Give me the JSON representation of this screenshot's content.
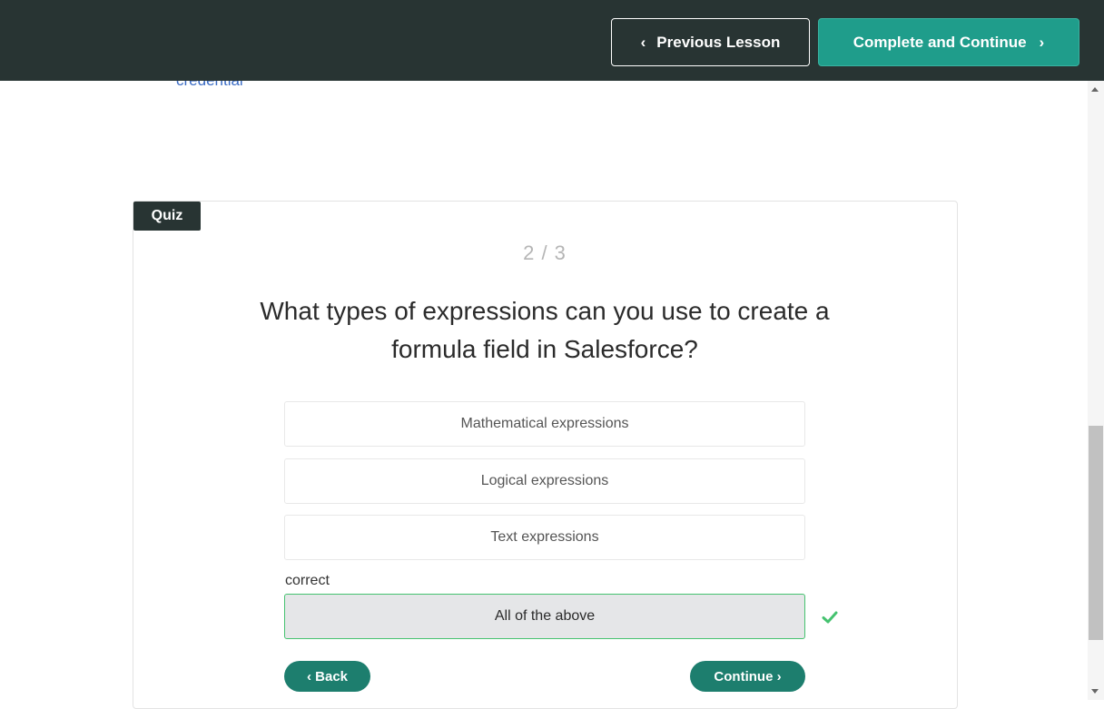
{
  "header": {
    "previous_label": "Previous Lesson",
    "complete_label": "Complete and Continue"
  },
  "content": {
    "cut_off_link": "credential"
  },
  "quiz": {
    "tag": "Quiz",
    "progress": "2 / 3",
    "question": "What types of expressions can you use to create a formula field in Salesforce?",
    "answers": [
      {
        "label": "Mathematical expressions",
        "selected": false
      },
      {
        "label": "Logical expressions",
        "selected": false
      },
      {
        "label": "Text expressions",
        "selected": false
      },
      {
        "label": "All of the above",
        "selected": true
      }
    ],
    "feedback_label": "correct",
    "back_label": "‹ Back",
    "continue_label": "Continue ›"
  },
  "colors": {
    "topbar": "#283433",
    "accent": "#1f9d8b",
    "pill": "#1d7e6e",
    "correct": "#45c26f"
  }
}
